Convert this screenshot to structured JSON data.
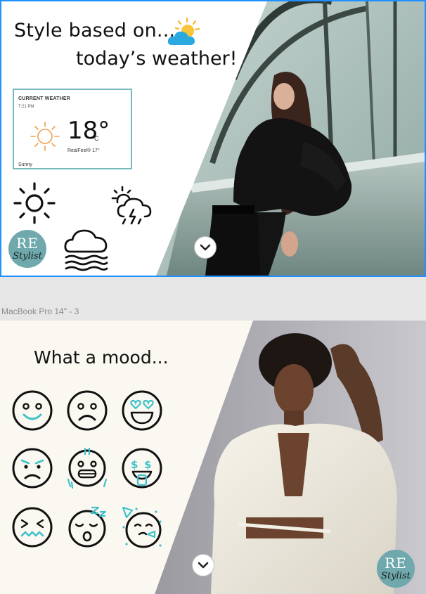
{
  "artboard1": {
    "headline_line1": "Style based on...",
    "headline_line2": "today’s weather!",
    "weather_card": {
      "title": "CURRENT WEATHER",
      "time": "7:21 PM",
      "temperature": "18°",
      "unit": "C",
      "realfeel": "RealFeel® 17°",
      "condition": "Sunny"
    },
    "icons": [
      "partly-cloudy-icon",
      "sun-icon",
      "thunderstorm-icon",
      "fog-icon",
      "chevron-down-icon"
    ],
    "logo": {
      "line1": "RE",
      "line2": "Stylist"
    }
  },
  "frame_label": "MacBook Pro 14\" - 3",
  "artboard2": {
    "headline": "What a mood...",
    "mood_icons": [
      "smile-emoji-icon",
      "sad-emoji-icon",
      "heart-eyes-emoji-icon",
      "angry-emoji-icon",
      "grimace-emoji-icon",
      "money-mouth-emoji-icon",
      "dizzy-emoji-icon",
      "sleepy-emoji-icon",
      "party-emoji-icon"
    ],
    "logo": {
      "line1": "RE",
      "line2": "Stylist"
    }
  },
  "colors": {
    "artboard_border": "#1e90ff",
    "accent_teal": "#3ec1c9",
    "logo_teal": "#6fa9ad",
    "card_border": "#78b9be",
    "sun_orange": "#f0a04b",
    "cream": "#fbf8f1"
  }
}
